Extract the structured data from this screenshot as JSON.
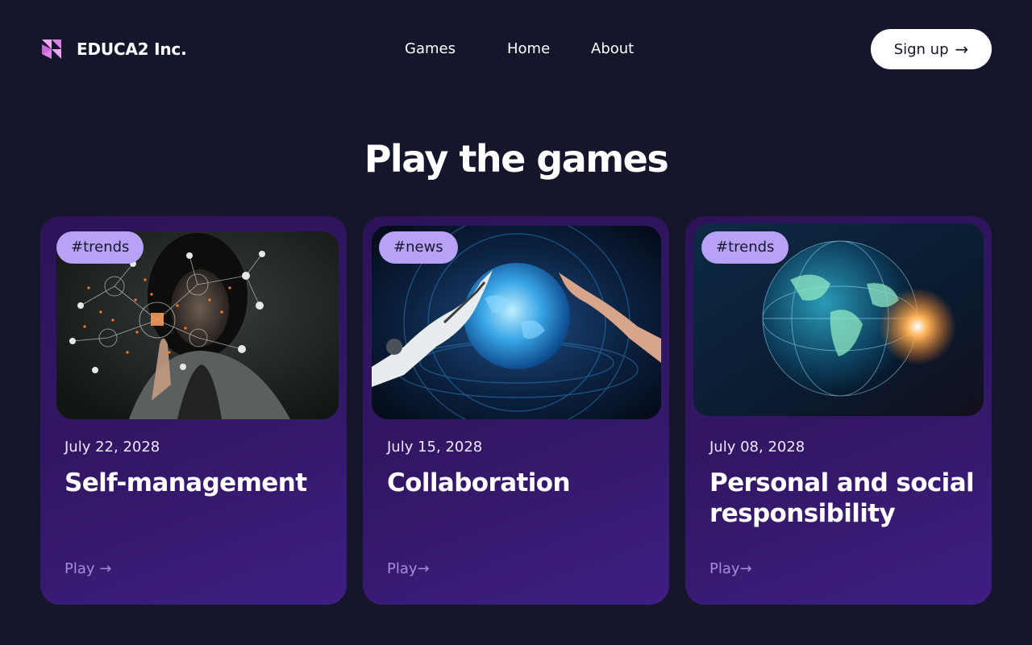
{
  "brand": {
    "name": "EDUCA2 Inc.",
    "logo_icon": "educa2-logo-icon"
  },
  "nav": {
    "items": [
      "Games",
      "Home",
      "About"
    ]
  },
  "signup": {
    "label": "Sign up",
    "arrow": "→"
  },
  "section": {
    "title": "Play the games"
  },
  "colors": {
    "background": "#15162b",
    "card_start": "#2c1358",
    "card_end": "#3e1f82",
    "tag_bg": "#b7a2f7",
    "accent": "#a48ce0",
    "logo": "#f2a5f5"
  },
  "cards": [
    {
      "tag": "#trends",
      "date": "July 22, 2028",
      "title": "Self-management",
      "play": "Play →",
      "image": "woman-touching-network-icons"
    },
    {
      "tag": "#news",
      "date": "July 15, 2028",
      "title": "Collaboration",
      "play": "Play→",
      "image": "robot-and-human-hands-globe"
    },
    {
      "tag": "#trends",
      "date": "July 08, 2028",
      "title": "Personal and social responsibility",
      "play": "Play→",
      "image": "digital-earth-globe"
    }
  ]
}
